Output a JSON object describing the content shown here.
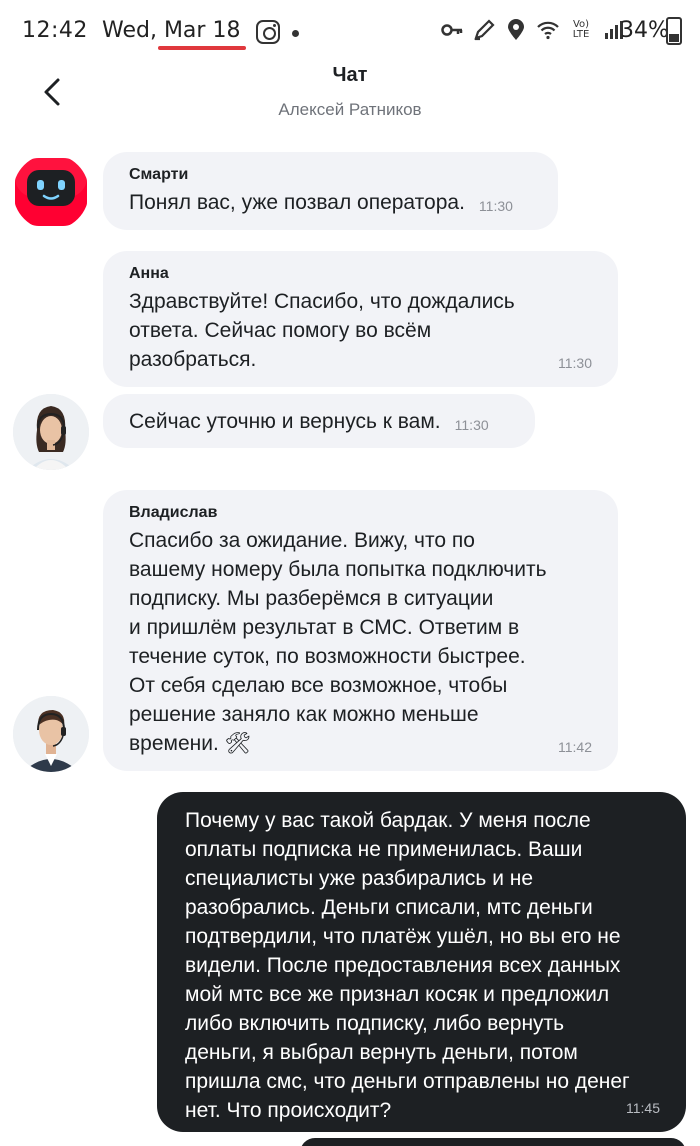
{
  "status_bar": {
    "time": "12:42",
    "date": "Wed, Mar 18",
    "battery": "34%",
    "volte_top": "Vo)",
    "volte_bottom": "LTE",
    "icons": [
      "instagram-icon",
      "key-icon",
      "pen-icon",
      "location-icon",
      "wifi-icon",
      "volte-icon",
      "signal-icon",
      "battery-icon"
    ]
  },
  "header": {
    "title": "Чат",
    "subtitle": "Алексей Ратников",
    "back_icon": "chevron-left-icon"
  },
  "messages": [
    {
      "sender": "Смарти",
      "text": "Понял вас, уже позвал оператора.",
      "time": "11:30",
      "avatar": "robot"
    },
    {
      "sender": "Анна",
      "lines": [
        "Здравствуйте! Спасибо, что дождались",
        "ответа. Сейчас помогу во всём",
        "разобраться."
      ],
      "time": "11:30"
    },
    {
      "sender": "",
      "text": "Сейчас уточню и вернусь к вам.",
      "time": "11:30",
      "avatar": "operator-woman"
    },
    {
      "sender": "Владислав",
      "lines": [
        "Спасибо за ожидание. Вижу, что по",
        "вашему номеру была попытка подключить",
        "подписку. Мы разберёмся в ситуации",
        "и пришлём результат в СМС. Ответим в",
        "течение суток, по возможности быстрее.",
        "От себя сделаю все возможное, чтобы",
        "решение заняло как можно меньше",
        "времени. 🛠"
      ],
      "time": "11:42",
      "avatar": "operator-man"
    }
  ],
  "outgoing": {
    "lines": [
      "Почему у вас такой бардак. У меня после",
      "оплаты подписка не применилась. Ваши",
      "специалисты уже разбирались и не",
      "разобрались. Деньги списали, мтс деньги",
      "подтвердили, что платёж ушёл, но вы его не",
      "видели. После предоставления всех данных",
      "мой мтс все же признал косяк и предложил",
      "либо включить подписку, либо вернуть",
      "деньги, я выбрал вернуть деньги, потом",
      "пришла смс, что деньги отправлены но денег",
      "нет. Что происходит?"
    ],
    "time": "11:45"
  },
  "colors": {
    "incoming_bubble": "#f2f3f7",
    "outgoing_bubble": "#1d2023",
    "accent_red": "#ff0032",
    "muted_text": "#6f737a"
  }
}
